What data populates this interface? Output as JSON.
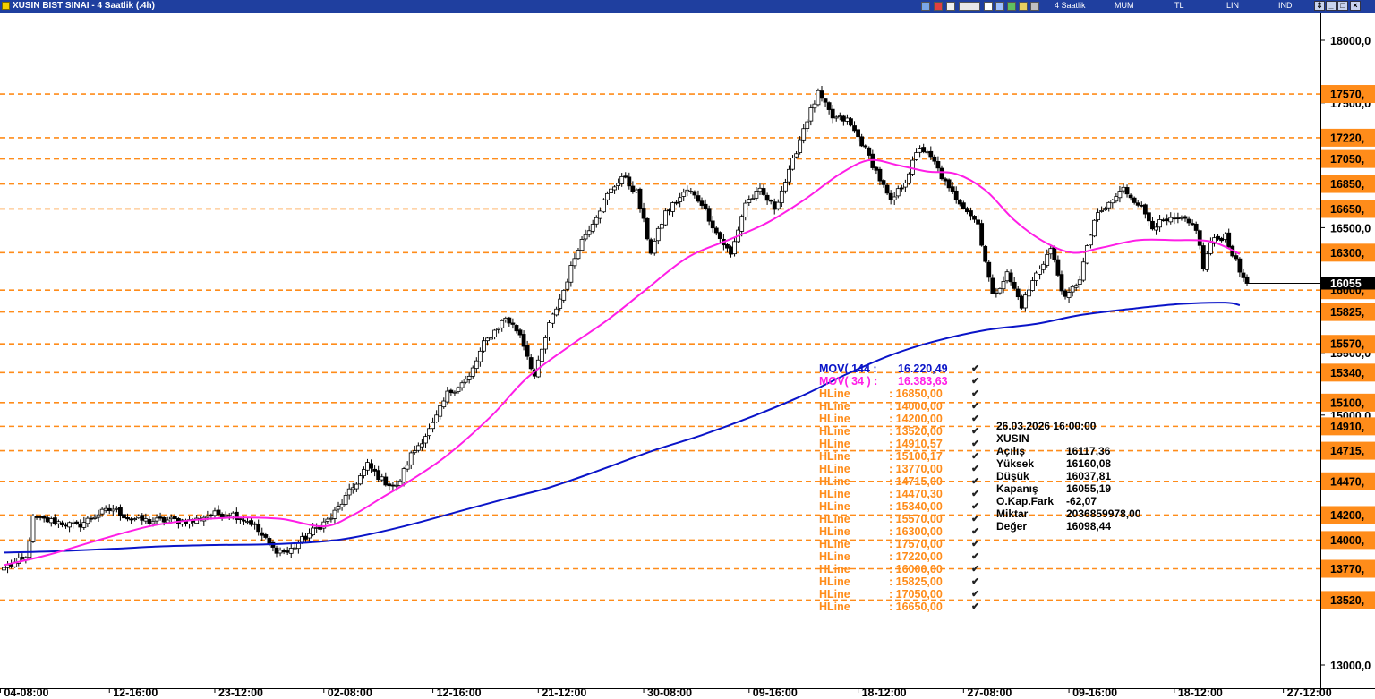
{
  "window": {
    "title": "XUSIN BIST SINAI - 4 Saatlik (.4h)",
    "period": "4 Saatlik",
    "candle_type": "MUM",
    "currency": "TL",
    "scale": "LIN",
    "mode": "IND"
  },
  "legend": {
    "mov144": {
      "label": "MOV( 144 :",
      "value": "16.220,49",
      "color": "#0a14c8"
    },
    "mov34": {
      "label": "MOV( 34 ) :",
      "value": "16.383,63",
      "color": "#ff1ee6"
    },
    "hlines": [
      {
        "label": "HLine",
        "value": ": 16850,00"
      },
      {
        "label": "HLine",
        "value": ": 14000,00"
      },
      {
        "label": "HLine",
        "value": ": 14200,00"
      },
      {
        "label": "HLine",
        "value": ": 13520,00"
      },
      {
        "label": "HLine",
        "value": ": 14910,57"
      },
      {
        "label": "HLine",
        "value": ": 15100,17"
      },
      {
        "label": "HLine",
        "value": ": 13770,00"
      },
      {
        "label": "HLine",
        "value": ": 14715,00"
      },
      {
        "label": "HLine",
        "value": ": 14470,30"
      },
      {
        "label": "HLine",
        "value": ": 15340,00"
      },
      {
        "label": "HLine",
        "value": ": 15570,00"
      },
      {
        "label": "HLine",
        "value": ": 16300,00"
      },
      {
        "label": "HLine",
        "value": ": 17570,00"
      },
      {
        "label": "HLine",
        "value": ": 17220,00"
      },
      {
        "label": "HLine",
        "value": ": 16000,00"
      },
      {
        "label": "HLine",
        "value": ": 15825,00"
      },
      {
        "label": "HLine",
        "value": ": 17050,00"
      },
      {
        "label": "HLine",
        "value": ": 16650,00"
      }
    ],
    "hline_color": "#ff8c1a",
    "check_glyph": "✔"
  },
  "info": {
    "datetime": "26.03.2026  16:00:00",
    "symbol": "XUSIN",
    "rows": [
      {
        "k": "Açılış",
        "v": "16117,36"
      },
      {
        "k": "Yüksek",
        "v": "16160,08"
      },
      {
        "k": "Düşük",
        "v": "16037,81"
      },
      {
        "k": "Kapanış",
        "v": "16055,19"
      },
      {
        "k": "O.Kap.Fark",
        "v": "-62,07"
      },
      {
        "k": "Miktar",
        "v": "2036859978,00"
      },
      {
        "k": "Değer",
        "v": "16098,44"
      }
    ]
  },
  "chart_data": {
    "type": "candlestick",
    "title": "XUSIN BIST SINAI - 4 Saatlik (.4h)",
    "ylim": [
      12950,
      18150
    ],
    "y_ticks": [
      "18000,0",
      "17500,0",
      "16500,0",
      "15500,0",
      "15000,0",
      "13000,0"
    ],
    "y_tick_values": [
      18000,
      17500,
      16500,
      15500,
      15000,
      13000
    ],
    "current_price_label": "16055",
    "current_price": 16055,
    "x_ticks": [
      "04-08:00",
      "12-16:00",
      "23-12:00",
      "02-08:00",
      "12-16:00",
      "21-12:00",
      "30-08:00",
      "09-16:00",
      "18-12:00",
      "27-08:00",
      "09-16:00",
      "18-12:00",
      "27-12:00"
    ],
    "x_tick_index": [
      -1,
      29,
      58,
      88,
      118,
      147,
      176,
      205,
      235,
      264,
      293,
      322,
      352
    ],
    "hlines": [
      {
        "value": 17570,
        "label": "17570,"
      },
      {
        "value": 17220,
        "label": "17220,"
      },
      {
        "value": 17050,
        "label": "17050,"
      },
      {
        "value": 16850,
        "label": "16850,"
      },
      {
        "value": 16650,
        "label": "16650,"
      },
      {
        "value": 16300,
        "label": "16300,"
      },
      {
        "value": 16000,
        "label": "16000,"
      },
      {
        "value": 15825,
        "label": "15825,"
      },
      {
        "value": 15570,
        "label": "15570,"
      },
      {
        "value": 15340,
        "label": "15340,"
      },
      {
        "value": 15100,
        "label": "15100,"
      },
      {
        "value": 14910,
        "label": "14910,"
      },
      {
        "value": 14715,
        "label": "14715,"
      },
      {
        "value": 14470,
        "label": "14470,"
      },
      {
        "value": 14200,
        "label": "14200,"
      },
      {
        "value": 14000,
        "label": "14000,"
      },
      {
        "value": 13770,
        "label": "13770,"
      },
      {
        "value": 13520,
        "label": "13520,"
      }
    ],
    "close_path": [
      [
        0,
        13780
      ],
      [
        6,
        13850
      ],
      [
        8,
        14170
      ],
      [
        14,
        14150
      ],
      [
        20,
        14110
      ],
      [
        26,
        14210
      ],
      [
        30,
        14250
      ],
      [
        34,
        14180
      ],
      [
        40,
        14150
      ],
      [
        46,
        14160
      ],
      [
        52,
        14150
      ],
      [
        56,
        14200
      ],
      [
        62,
        14220
      ],
      [
        68,
        14140
      ],
      [
        74,
        13930
      ],
      [
        78,
        13900
      ],
      [
        84,
        14050
      ],
      [
        90,
        14180
      ],
      [
        96,
        14420
      ],
      [
        100,
        14600
      ],
      [
        104,
        14480
      ],
      [
        108,
        14420
      ],
      [
        112,
        14680
      ],
      [
        118,
        14920
      ],
      [
        122,
        15170
      ],
      [
        128,
        15300
      ],
      [
        132,
        15570
      ],
      [
        138,
        15780
      ],
      [
        142,
        15650
      ],
      [
        146,
        15310
      ],
      [
        150,
        15720
      ],
      [
        154,
        16000
      ],
      [
        158,
        16350
      ],
      [
        162,
        16550
      ],
      [
        166,
        16760
      ],
      [
        170,
        16910
      ],
      [
        174,
        16780
      ],
      [
        178,
        16310
      ],
      [
        182,
        16620
      ],
      [
        188,
        16800
      ],
      [
        192,
        16700
      ],
      [
        196,
        16460
      ],
      [
        200,
        16280
      ],
      [
        204,
        16700
      ],
      [
        208,
        16790
      ],
      [
        212,
        16660
      ],
      [
        216,
        16940
      ],
      [
        220,
        17300
      ],
      [
        224,
        17570
      ],
      [
        228,
        17380
      ],
      [
        232,
        17360
      ],
      [
        236,
        17180
      ],
      [
        240,
        16950
      ],
      [
        244,
        16700
      ],
      [
        248,
        16880
      ],
      [
        252,
        17150
      ],
      [
        256,
        17020
      ],
      [
        260,
        16800
      ],
      [
        264,
        16680
      ],
      [
        268,
        16530
      ],
      [
        272,
        15950
      ],
      [
        276,
        16130
      ],
      [
        280,
        15880
      ],
      [
        284,
        16130
      ],
      [
        288,
        16330
      ],
      [
        292,
        15920
      ],
      [
        296,
        16100
      ],
      [
        300,
        16560
      ],
      [
        304,
        16690
      ],
      [
        308,
        16810
      ],
      [
        312,
        16700
      ],
      [
        316,
        16520
      ],
      [
        320,
        16550
      ],
      [
        324,
        16560
      ],
      [
        328,
        16500
      ],
      [
        330,
        16180
      ],
      [
        332,
        16380
      ],
      [
        336,
        16440
      ],
      [
        340,
        16150
      ],
      [
        342,
        16055
      ]
    ],
    "series": [
      {
        "name": "MOV( 144 :",
        "color": "#0a14c8",
        "points": [
          [
            0,
            13900
          ],
          [
            14,
            13910
          ],
          [
            30,
            13930
          ],
          [
            44,
            13950
          ],
          [
            58,
            13960
          ],
          [
            72,
            13965
          ],
          [
            86,
            13985
          ],
          [
            96,
            14020
          ],
          [
            110,
            14110
          ],
          [
            124,
            14220
          ],
          [
            138,
            14330
          ],
          [
            150,
            14420
          ],
          [
            164,
            14560
          ],
          [
            178,
            14710
          ],
          [
            192,
            14840
          ],
          [
            206,
            14990
          ],
          [
            220,
            15160
          ],
          [
            232,
            15330
          ],
          [
            244,
            15480
          ],
          [
            256,
            15590
          ],
          [
            270,
            15680
          ],
          [
            284,
            15730
          ],
          [
            296,
            15800
          ],
          [
            310,
            15850
          ],
          [
            324,
            15890
          ],
          [
            336,
            15900
          ],
          [
            340,
            15880
          ]
        ]
      },
      {
        "name": "MOV( 34 ) :",
        "color": "#ff1ee6",
        "points": [
          [
            0,
            13800
          ],
          [
            12,
            13880
          ],
          [
            26,
            14000
          ],
          [
            40,
            14110
          ],
          [
            52,
            14160
          ],
          [
            64,
            14180
          ],
          [
            76,
            14170
          ],
          [
            88,
            14110
          ],
          [
            96,
            14200
          ],
          [
            104,
            14340
          ],
          [
            112,
            14480
          ],
          [
            122,
            14680
          ],
          [
            134,
            14990
          ],
          [
            144,
            15300
          ],
          [
            156,
            15560
          ],
          [
            166,
            15760
          ],
          [
            176,
            15990
          ],
          [
            188,
            16260
          ],
          [
            200,
            16410
          ],
          [
            210,
            16540
          ],
          [
            220,
            16720
          ],
          [
            230,
            16930
          ],
          [
            238,
            17040
          ],
          [
            246,
            17000
          ],
          [
            254,
            16950
          ],
          [
            262,
            16930
          ],
          [
            270,
            16800
          ],
          [
            278,
            16560
          ],
          [
            286,
            16390
          ],
          [
            294,
            16300
          ],
          [
            302,
            16340
          ],
          [
            312,
            16400
          ],
          [
            322,
            16400
          ],
          [
            332,
            16390
          ],
          [
            340,
            16290
          ]
        ]
      }
    ]
  }
}
